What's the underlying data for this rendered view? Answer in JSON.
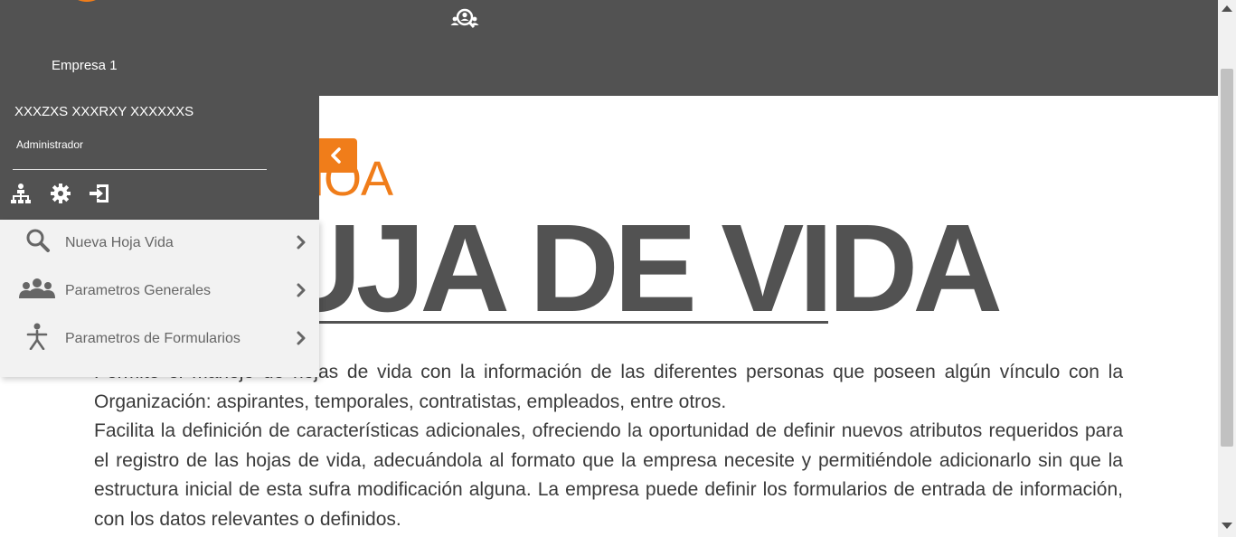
{
  "header": {
    "company_name": "Empresa 1",
    "search_people_icon": "people-search-icon"
  },
  "user": {
    "name": "XXXZXS XXXRXY XXXXXXS",
    "role": "Administrador",
    "actions": [
      {
        "icon": "org-chart-icon"
      },
      {
        "icon": "gear-icon"
      },
      {
        "icon": "logout-icon"
      }
    ]
  },
  "menu": {
    "items": [
      {
        "label": "Nueva Hoja Vida",
        "icon": "search-icon"
      },
      {
        "label": "Parametros Generales",
        "icon": "people-group-icon"
      },
      {
        "label": "Parametros de Formularios",
        "icon": "person-icon"
      }
    ]
  },
  "main": {
    "subtitle": "HOA",
    "title": "UJA DE VIDA",
    "paragraph1": "Permite el manejo de hojas de vida con la información de las diferentes personas que poseen algún vínculo con la Organización: aspirantes, temporales, contratistas, empleados, entre otros.",
    "paragraph2": "Facilita la definición de características adicionales, ofreciendo la oportunidad de definir nuevos atributos requeridos para el registro de las hojas de vida, adecuándola al formato que la empresa necesite y permitiéndole adicionarlo sin que la estructura inicial de esta sufra modificación alguna. La empresa puede definir los formularios de entrada de información, con los datos relevantes o definidos."
  },
  "colors": {
    "accent": "#f07d1a",
    "header_bg": "#525252",
    "menu_bg": "#f2f2f2"
  }
}
